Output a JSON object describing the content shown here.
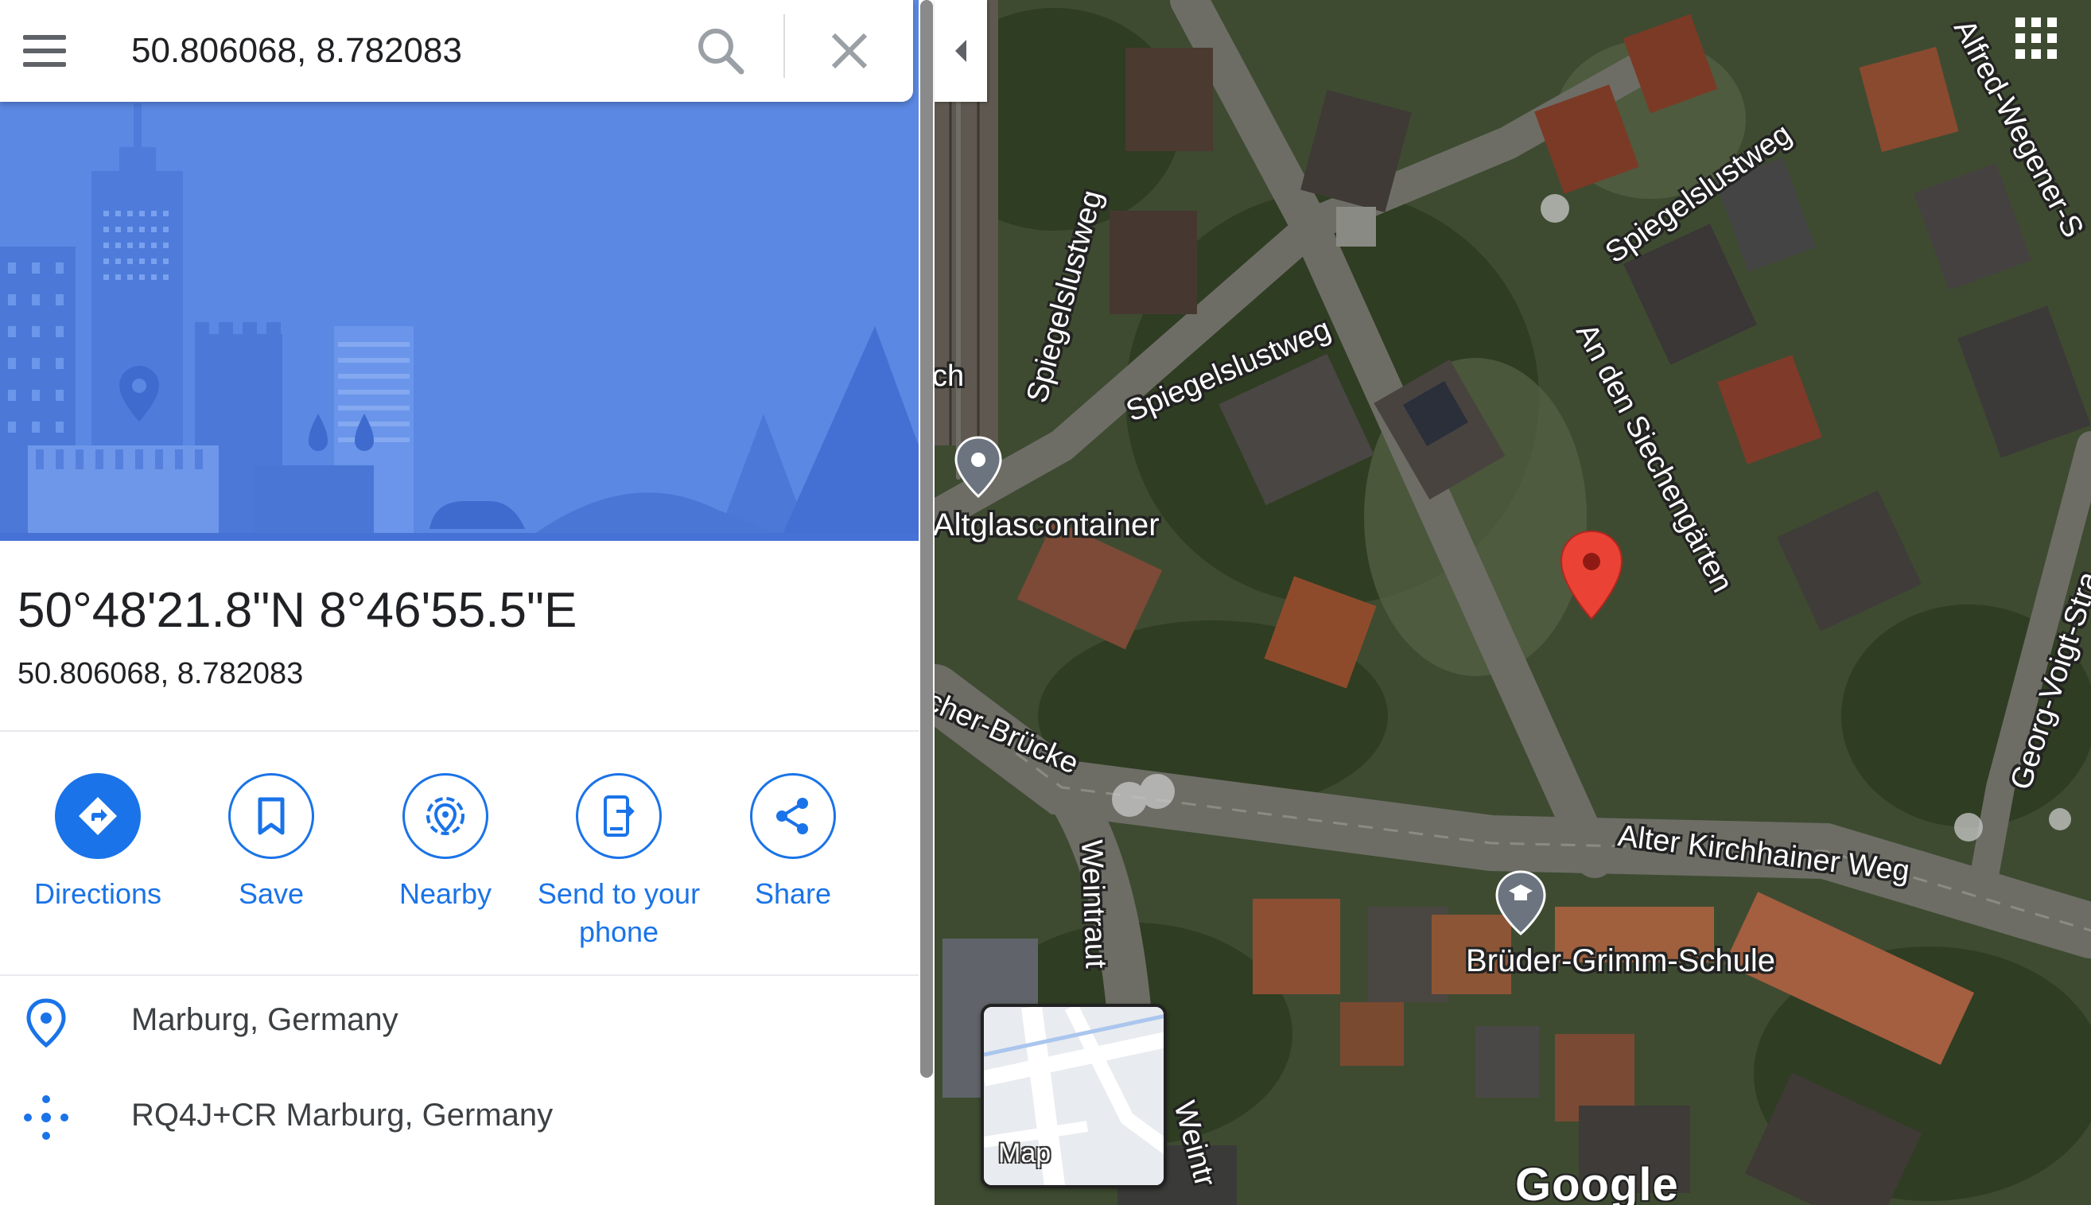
{
  "search": {
    "query": "50.806068, 8.782083",
    "menu_icon": "hamburger-menu-icon",
    "search_icon": "search-icon",
    "close_icon": "close-icon"
  },
  "place": {
    "coords_dms": "50°48'21.8\"N 8°46'55.5\"E",
    "coords_decimal": "50.806068, 8.782083"
  },
  "actions": [
    {
      "label": "Directions",
      "icon": "directions-icon"
    },
    {
      "label": "Save",
      "icon": "bookmark-icon"
    },
    {
      "label": "Nearby",
      "icon": "nearby-icon"
    },
    {
      "label": "Send to your phone",
      "icon": "send-to-phone-icon"
    },
    {
      "label": "Share",
      "icon": "share-icon"
    }
  ],
  "info": {
    "locality": "Marburg, Germany",
    "plus_code": "RQ4J+CR Marburg, Germany"
  },
  "map": {
    "streets": {
      "spiegelslustweg_1": "Spiegelslustweg",
      "spiegelslustweg_2": "Spiegelslustweg",
      "spiegelslustweg_3": "Spiegelslustweg",
      "an_den_siechengaerten": "An den Siechengärten",
      "alfred_wegener": "Alfred-Wegener-S",
      "georg_voigt": "Georg-Voigt-Stra",
      "bruecke": "cher-Brücke",
      "alter_kirchhainer_weg": "Alter Kirchhainer Weg",
      "weintraut_1": "Weintraut",
      "weintraut_2": "Weintr",
      "edge_fragment": "ch"
    },
    "pois": {
      "altglascontainer": "Altglascontainer",
      "school": "Brüder-Grimm-Schule"
    },
    "layer_toggle_label": "Map",
    "brand": "Google"
  },
  "colors": {
    "accent": "#1a73e8",
    "hero_bg": "#5a87e2",
    "pin": "#ea4335"
  }
}
